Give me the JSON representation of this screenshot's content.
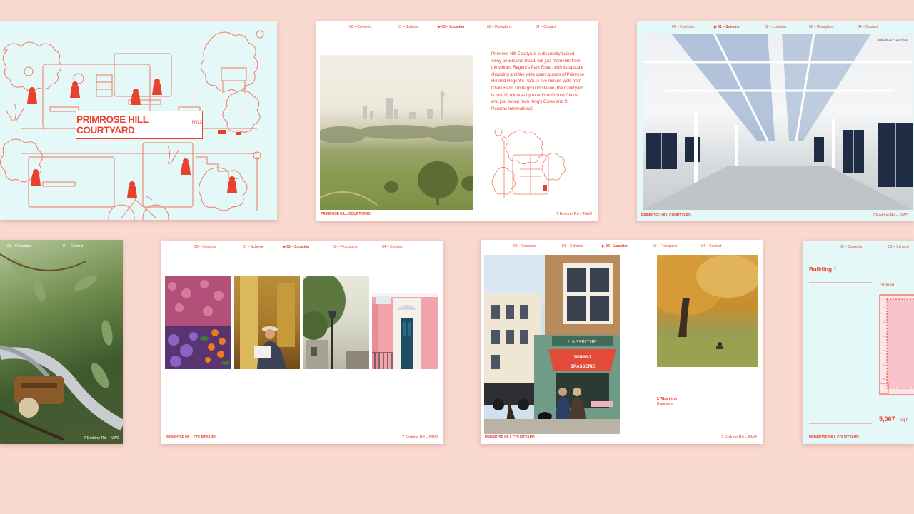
{
  "colors": {
    "background": "#f9d8d0",
    "accent": "#e8412e",
    "mint": "#e4f8f7"
  },
  "card1": {
    "title": "PRIMROSE HILL COURTYARD",
    "postcode": "NW3"
  },
  "card2": {
    "nav": [
      "00 – Contents",
      "01 – Scheme",
      "03 – Location",
      "03 – Floorplans",
      "04 – Contact"
    ],
    "paragraph": "Primrose Hill Courtyard is discreetly tucked away on Erskine Road, but just moments from the vibrant Regent's Park Road, with its upscale shopping and the wide open spaces of Primrose Hill and Regent's Park. A five-minute walk from Chalk Farm Underground station, the Courtyard is just 10 minutes by tube from Oxford Circus and just seven from King's Cross and St Pancras International.",
    "footer_left": "PRIMROSE HILL COURTYARD",
    "footer_right": "7 Erskine Rd – NW3"
  },
  "card3": {
    "nav": [
      "00 – Contents",
      "01 – Scheme",
      "02 – Location",
      "03 – Floorplans",
      "04 – Contact"
    ],
    "caption": "Building 2 – 1st Floor",
    "footer_left": "PRIMROSE HILL COURTYARD",
    "footer_right": "7 Erskine Rd – NW3"
  },
  "card4": {
    "nav": [
      "03 – Floorplans",
      "04 – Contact"
    ],
    "footer_right": "7 Erskine Rd – NW3"
  },
  "card5": {
    "nav": [
      "00 – Contents",
      "01 – Scheme",
      "02 – Location",
      "03 – Floorplans",
      "04 – Contact"
    ],
    "footer_left": "PRIMROSE HILL COURTYARD",
    "footer_right": "7 Erskine Rd – NW3"
  },
  "card6": {
    "nav": [
      "00 – Contents",
      "01 – Scheme",
      "02 – Location",
      "03 – Floorplans",
      "04 – Contact"
    ],
    "caption_title": "L'Absinthe",
    "caption_sub": "Brasserie",
    "sign_top": "L'ABSINTHE",
    "sign_awning": "THIERRY",
    "sign_brasserie": "BRASSERIE",
    "footer_left": "PRIMROSE HILL COURTYARD",
    "footer_right": "7 Erskine Rd – NW3"
  },
  "card7": {
    "nav": [
      "00 – Contents",
      "01 – Scheme"
    ],
    "building": "Building 1",
    "floor": "Ground",
    "area": "5,067",
    "unit": "sq ft",
    "footer_left": "PRIMROSE HILL COURTYARD"
  }
}
